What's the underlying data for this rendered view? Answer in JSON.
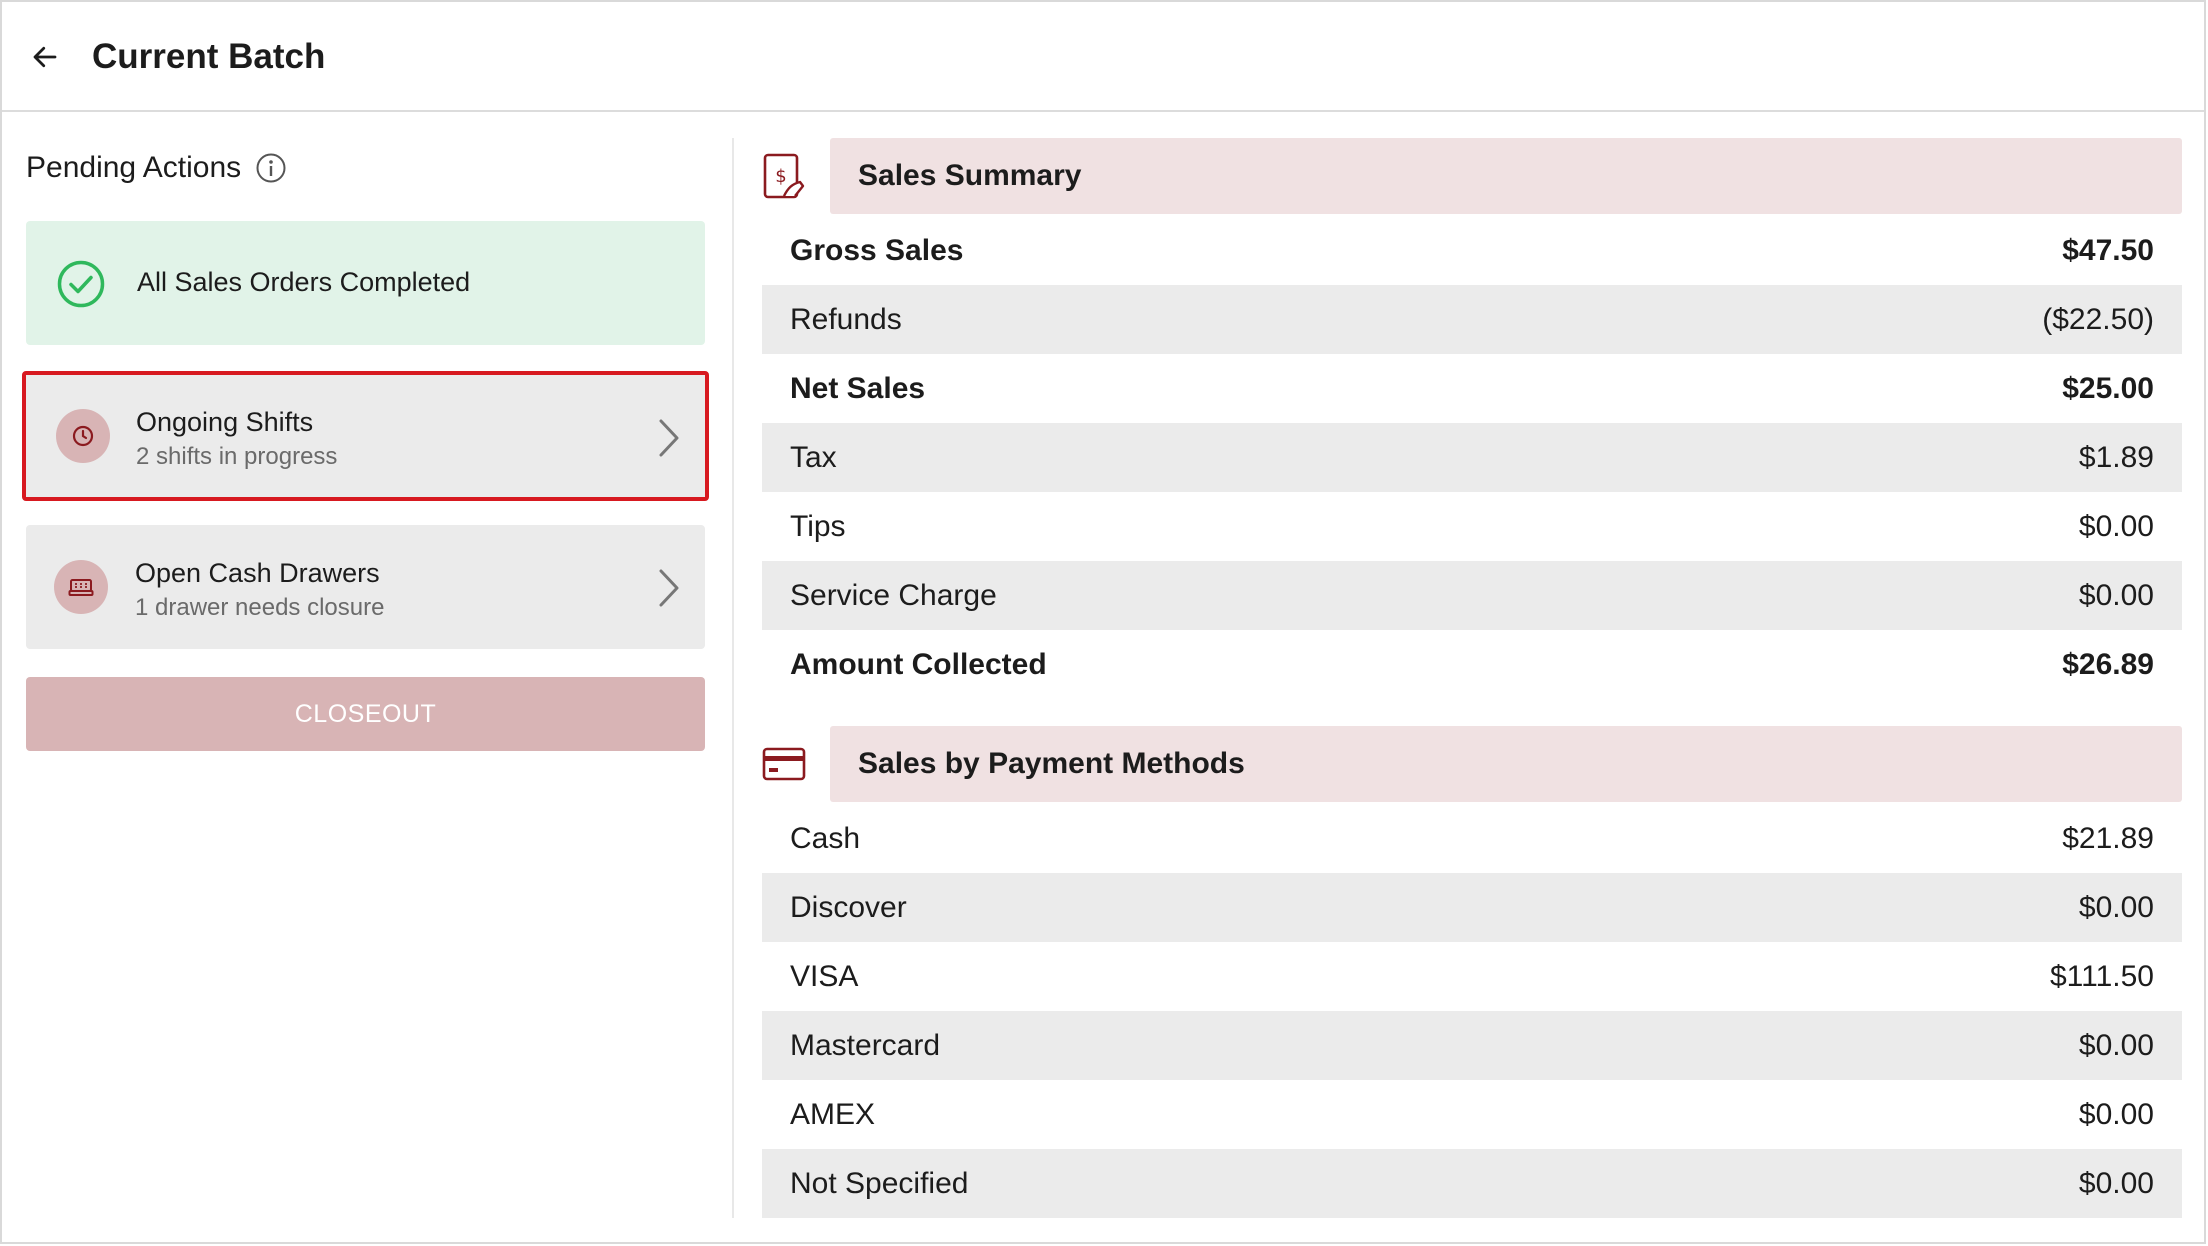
{
  "header": {
    "title": "Current Batch"
  },
  "pending": {
    "title": "Pending Actions",
    "success_card": {
      "title": "All Sales Orders Completed"
    },
    "shifts_card": {
      "title": "Ongoing Shifts",
      "subtitle": "2 shifts in progress"
    },
    "drawers_card": {
      "title": "Open Cash Drawers",
      "subtitle": "1 drawer needs closure"
    },
    "closeout_label": "CLOSEOUT"
  },
  "sales_summary": {
    "title": "Sales Summary",
    "rows": [
      {
        "label": "Gross Sales",
        "value": "$47.50",
        "bold": true
      },
      {
        "label": "Refunds",
        "value": "($22.50)",
        "bold": false
      },
      {
        "label": "Net Sales",
        "value": "$25.00",
        "bold": true
      },
      {
        "label": "Tax",
        "value": "$1.89",
        "bold": false
      },
      {
        "label": "Tips",
        "value": "$0.00",
        "bold": false
      },
      {
        "label": "Service Charge",
        "value": "$0.00",
        "bold": false
      },
      {
        "label": "Amount Collected",
        "value": "$26.89",
        "bold": true
      }
    ]
  },
  "payment_methods": {
    "title": "Sales by Payment Methods",
    "rows": [
      {
        "label": "Cash",
        "value": "$21.89"
      },
      {
        "label": "Discover",
        "value": "$0.00"
      },
      {
        "label": "VISA",
        "value": "$111.50"
      },
      {
        "label": "Mastercard",
        "value": "$0.00"
      },
      {
        "label": "AMEX",
        "value": "$0.00"
      },
      {
        "label": "Not Specified",
        "value": "$0.00"
      }
    ]
  },
  "colors": {
    "accent": "#8b1a1f",
    "success": "#2fb85c",
    "highlight_border": "#d71920",
    "section_bg": "#f0e1e2"
  }
}
